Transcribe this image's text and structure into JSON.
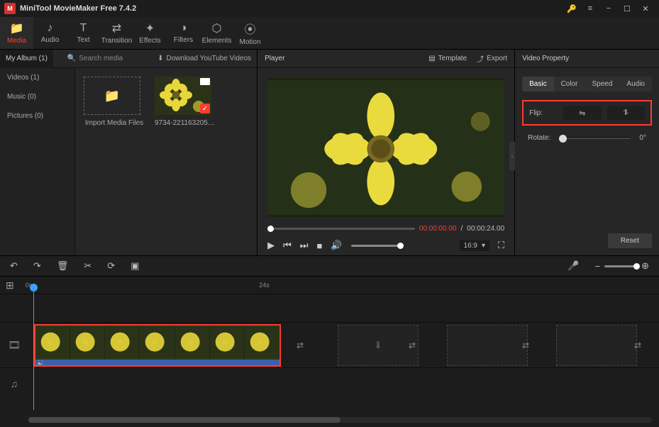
{
  "app": {
    "title": "MiniTool MovieMaker Free 7.4.2"
  },
  "toolbar": {
    "media": "Media",
    "audio": "Audio",
    "text": "Text",
    "transition": "Transition",
    "effects": "Effects",
    "filters": "Filters",
    "elements": "Elements",
    "motion": "Motion"
  },
  "mediabar": {
    "album": "My Album (1)",
    "search_placeholder": "Search media",
    "download": "Download YouTube Videos"
  },
  "categories": {
    "videos": "Videos (1)",
    "music": "Music (0)",
    "pictures": "Pictures (0)"
  },
  "media_items": {
    "import": "Import Media Files",
    "clip1": "9734-221163205_s..."
  },
  "player": {
    "title": "Player",
    "template": "Template",
    "export": "Export",
    "time_current": "00:00:00.00",
    "time_sep": " / ",
    "time_total": "00:00:24.00",
    "aspect": "16:9"
  },
  "props": {
    "title": "Video Property",
    "tab_basic": "Basic",
    "tab_color": "Color",
    "tab_speed": "Speed",
    "tab_audio": "Audio",
    "flip_label": "Flip:",
    "rotate_label": "Rotate:",
    "rotate_value": "0°",
    "reset": "Reset"
  },
  "timeline": {
    "t0": "0s",
    "t1": "24s"
  },
  "icons": {
    "folder": "📁",
    "note": "♪",
    "tt": "T",
    "trans": "⇄",
    "fx": "✦",
    "filter": "◑",
    "elem": "⬡",
    "motion": "⦿",
    "search": "🔍",
    "dl": "⬇",
    "layers": "▤",
    "upload": "⤴",
    "play": "▶",
    "prev": "⏮",
    "next": "⏭",
    "stop": "■",
    "vol": "🔊",
    "full": "⛶",
    "undo": "↶",
    "redo": "↷",
    "trash": "🗑",
    "cut": "✂",
    "rot": "⟳",
    "crop": "▣",
    "mic": "🎤",
    "minus": "−",
    "plus": "⊕",
    "fliph": "⇋",
    "flipv": "⥮",
    "key": "🔑",
    "menu": "≡",
    "min": "−",
    "max": "☐",
    "close": "✕",
    "film": "🎞",
    "music": "♫",
    "addtrack": "⊞",
    "chev": "▾",
    "left": "‹",
    "snd": "🔉"
  }
}
